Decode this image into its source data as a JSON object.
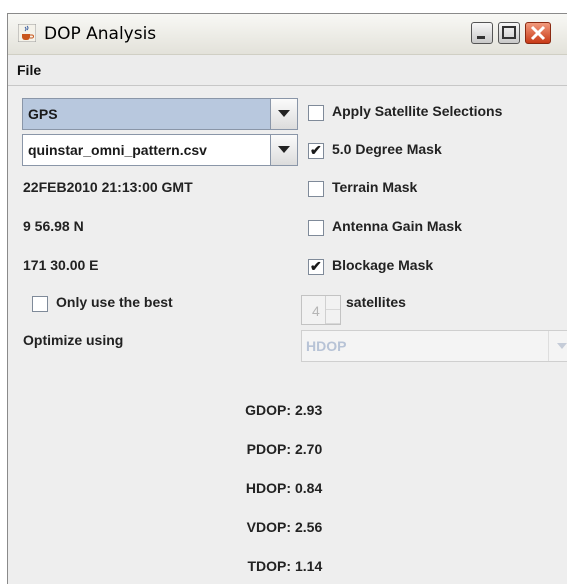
{
  "window": {
    "title": "DOP Analysis"
  },
  "menu": {
    "file": "File"
  },
  "left": {
    "constellation": "GPS",
    "pattern_file": "quinstar_omni_pattern.csv",
    "datetime": "22FEB2010  21:13:00 GMT",
    "latitude": "9 56.98 N",
    "longitude": "171 30.00 E",
    "only_best_label": "Only use the best",
    "optimize_label": "Optimize using"
  },
  "right": {
    "apply_selections": {
      "label": "Apply Satellite Selections",
      "checked": false
    },
    "degree_mask": {
      "label": "5.0 Degree Mask",
      "checked": true
    },
    "terrain_mask": {
      "label": "Terrain Mask",
      "checked": false
    },
    "antenna_gain_mask": {
      "label": "Antenna Gain Mask",
      "checked": false
    },
    "blockage_mask": {
      "label": "Blockage Mask",
      "checked": true
    },
    "satellites_count": "4",
    "satellites_label": "satellites",
    "optimize_value": "HDOP"
  },
  "dop": [
    {
      "key": "GDOP:",
      "value": "2.93"
    },
    {
      "key": "PDOP:",
      "value": "2.70"
    },
    {
      "key": "HDOP:",
      "value": "0.84"
    },
    {
      "key": "VDOP:",
      "value": "2.56"
    },
    {
      "key": "TDOP:",
      "value": "1.14"
    }
  ],
  "colors": {
    "selected_combo": "#b8c8de",
    "close_button": "#c83a17"
  }
}
